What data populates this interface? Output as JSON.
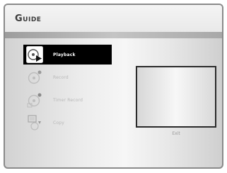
{
  "header": {
    "title": "Guide"
  },
  "menu": {
    "items": [
      {
        "label": "Playback",
        "icon": "disc-play-icon",
        "selected": true
      },
      {
        "label": "Record",
        "icon": "disc-record-icon",
        "selected": false
      },
      {
        "label": "Timer Record",
        "icon": "disc-timer-record-icon",
        "selected": false
      },
      {
        "label": "Copy",
        "icon": "copy-icon",
        "selected": false
      }
    ]
  },
  "preview": {
    "exit_label": "Exit"
  },
  "colors": {
    "selected_bg": "#000000",
    "selected_text": "#ffffff",
    "disabled_text": "#b8b8b8"
  }
}
